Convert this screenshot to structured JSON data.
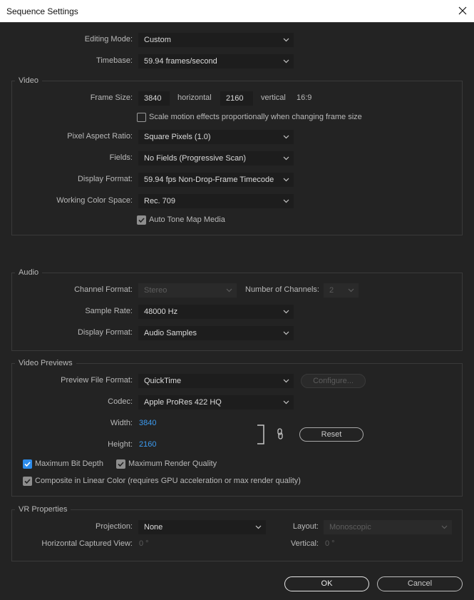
{
  "window": {
    "title": "Sequence Settings"
  },
  "editing_mode": {
    "label": "Editing Mode:",
    "value": "Custom"
  },
  "timebase": {
    "label": "Timebase:",
    "value": "59.94  frames/second"
  },
  "video": {
    "title": "Video",
    "frame_size_label": "Frame Size:",
    "frame_width": "3840",
    "horizontal_label": "horizontal",
    "frame_height": "2160",
    "vertical_label": "vertical",
    "aspect": "16:9",
    "scale_motion_label": "Scale motion effects proportionally when changing frame size",
    "scale_motion_checked": false,
    "pixel_aspect_label": "Pixel Aspect Ratio:",
    "pixel_aspect_value": "Square Pixels (1.0)",
    "fields_label": "Fields:",
    "fields_value": "No Fields (Progressive Scan)",
    "display_format_label": "Display Format:",
    "display_format_value": "59.94 fps Non-Drop-Frame Timecode",
    "color_space_label": "Working Color Space:",
    "color_space_value": "Rec. 709",
    "auto_tone_label": "Auto Tone Map Media",
    "auto_tone_checked": true
  },
  "audio": {
    "title": "Audio",
    "channel_format_label": "Channel Format:",
    "channel_format_value": "Stereo",
    "num_channels_label": "Number of Channels:",
    "num_channels_value": "2",
    "sample_rate_label": "Sample Rate:",
    "sample_rate_value": "48000 Hz",
    "display_format_label": "Display Format:",
    "display_format_value": "Audio Samples"
  },
  "previews": {
    "title": "Video Previews",
    "file_format_label": "Preview File Format:",
    "file_format_value": "QuickTime",
    "configure_label": "Configure...",
    "codec_label": "Codec:",
    "codec_value": "Apple ProRes 422 HQ",
    "width_label": "Width:",
    "width_value": "3840",
    "height_label": "Height:",
    "height_value": "2160",
    "reset_label": "Reset",
    "max_bit_depth_label": "Maximum Bit Depth",
    "max_bit_depth_checked": true,
    "max_render_label": "Maximum Render Quality",
    "max_render_checked": true,
    "composite_label": "Composite in Linear Color (requires GPU acceleration or max render quality)",
    "composite_checked": true
  },
  "vr": {
    "title": "VR Properties",
    "projection_label": "Projection:",
    "projection_value": "None",
    "layout_label": "Layout:",
    "layout_value": "Monoscopic",
    "h_view_label": "Horizontal Captured View:",
    "h_view_value": "0 °",
    "vertical_label": "Vertical:",
    "vertical_value": "0 °"
  },
  "buttons": {
    "ok": "OK",
    "cancel": "Cancel"
  },
  "colors": {
    "background": "#232323",
    "accent": "#2d8ceb",
    "link": "#3c9bf0"
  }
}
